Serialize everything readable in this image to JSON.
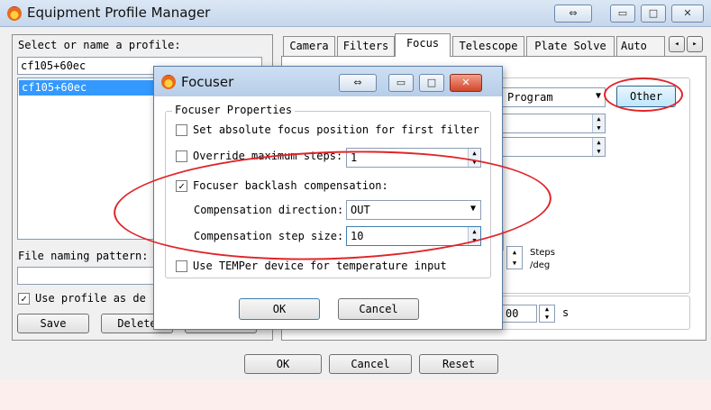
{
  "main_window": {
    "title": "Equipment Profile Manager",
    "restore_glyph": "⇔",
    "minimize_glyph": "▭",
    "maximize_glyph": "□",
    "close_glyph": "✕"
  },
  "profile_panel": {
    "select_label": "Select or name a profile:",
    "name_value": "cf105+60ec",
    "profiles": [
      "cf105+60ec"
    ],
    "file_naming_label": "File naming pattern:",
    "use_profile_label": "Use profile as de",
    "use_profile_checked": true,
    "save_label": "Save",
    "delete_label": "Delete"
  },
  "tabs": [
    "Camera",
    "Filters",
    "Focus",
    "Telescope",
    "Plate Solve",
    "Auto Gu"
  ],
  "active_tab": "Focus",
  "focus_tab": {
    "program_value": "Program",
    "other_label": "Other",
    "steps_label_line1": "Steps",
    "steps_label_line2": "/deg",
    "seconds_value": "00",
    "seconds_unit": "s"
  },
  "focuser_dialog": {
    "title": "Focuser",
    "group_label": "Focuser Properties",
    "abs_focus_label": "Set absolute focus position for first filter",
    "abs_focus_checked": false,
    "override_label": "Override maximum steps:",
    "override_checked": false,
    "override_value": "1",
    "backlash_label": "Focuser backlash compensation:",
    "backlash_checked": true,
    "direction_label": "Compensation direction:",
    "direction_value": "OUT",
    "step_size_label": "Compensation step size:",
    "step_size_value": "10",
    "temper_label": "Use TEMPer device for temperature input",
    "temper_checked": false,
    "ok_label": "OK",
    "cancel_label": "Cancel"
  },
  "main_buttons": {
    "ok_label": "OK",
    "cancel_label": "Cancel",
    "reset_label": "Reset"
  },
  "colors": {
    "annotation_red": "#e0242a",
    "titlebar_blue": "#c6d7ec"
  }
}
